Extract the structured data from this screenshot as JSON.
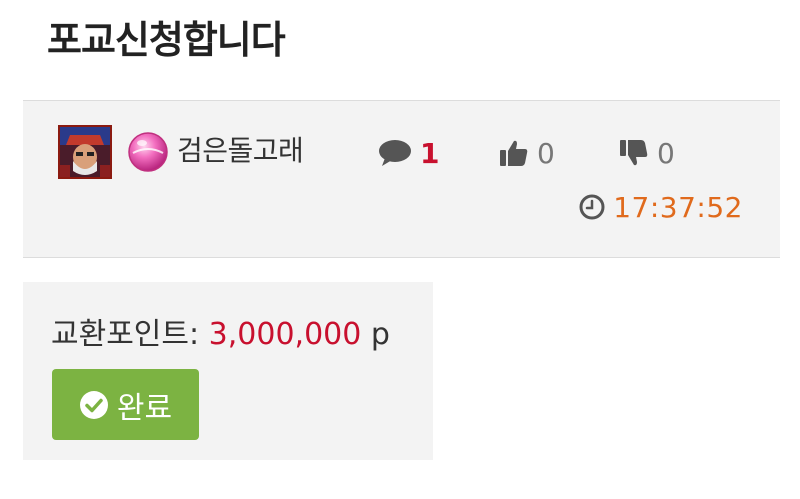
{
  "page": {
    "title": "포교신청합니다"
  },
  "post_meta": {
    "avatar_icon": "user-avatar-icon",
    "level_icon": "pink-orb-icon",
    "author": "검은돌고래",
    "comments": {
      "icon": "comment-icon",
      "count": "1"
    },
    "likes": {
      "icon": "thumbs-up-icon",
      "count": "0"
    },
    "dislikes": {
      "icon": "thumbs-down-icon",
      "count": "0"
    },
    "time": {
      "icon": "clock-icon",
      "value": "17:37:52"
    }
  },
  "exchange": {
    "label": "교환포인트:",
    "value": "3,000,000",
    "unit": "p",
    "status_button": {
      "icon": "check-circle-icon",
      "label": "완료"
    }
  },
  "colors": {
    "accent_red": "#c8102e",
    "time_orange": "#e06a1c",
    "button_green": "#7cb342",
    "panel_bg": "#f3f3f3"
  }
}
